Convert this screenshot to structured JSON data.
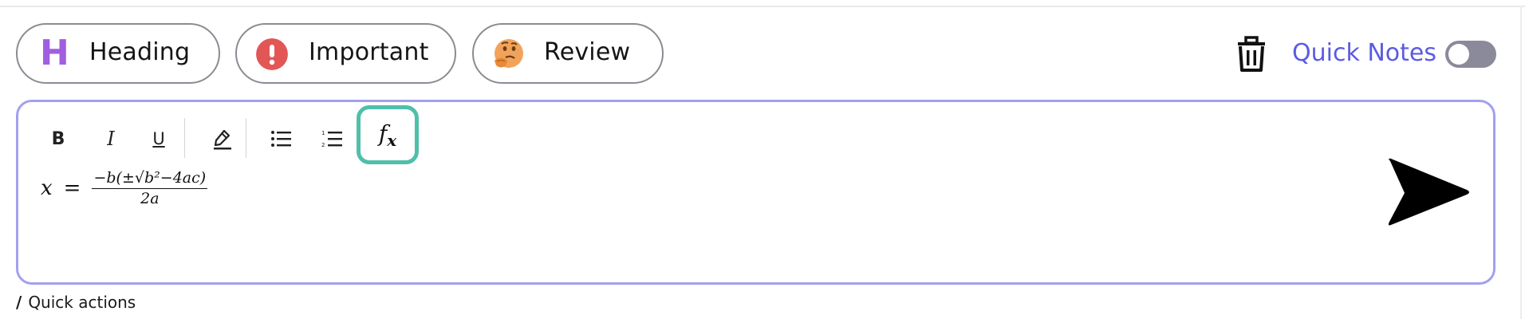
{
  "tags": [
    {
      "label": "Heading",
      "icon": "heading-h-icon",
      "icon_glyph": "H",
      "color": "#a25ee0"
    },
    {
      "label": "Important",
      "icon": "exclamation-icon",
      "color": "#e25656"
    },
    {
      "label": "Review",
      "icon": "thinking-face-icon",
      "color": "#f2a35b"
    }
  ],
  "header": {
    "quick_notes_label": "Quick Notes",
    "quick_notes_enabled": false,
    "accent_color": "#5b5be2"
  },
  "toolbar": {
    "bold": "B",
    "italic": "I",
    "underline": "U",
    "formula": "f",
    "formula_sub": "x",
    "active_tool": "formula",
    "active_color": "#4fbfaa"
  },
  "editor": {
    "border_color": "#a39ff0",
    "formula_lhs": "x",
    "formula_eq": "=",
    "formula_numerator": "−b(±√b²−4ac)",
    "formula_denominator": "2a"
  },
  "footer": {
    "slash": "/",
    "hint": "Quick actions"
  }
}
